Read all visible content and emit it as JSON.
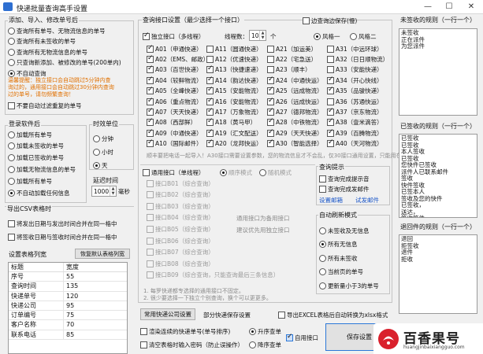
{
  "window": {
    "title": "快递批量查询高手设置",
    "min": "—",
    "max": "☐",
    "close": "✕"
  },
  "add_group": {
    "title": "添加、导入、修改单号后",
    "options": [
      {
        "label": "查询所有单号、无物流信息的单号",
        "checked": false
      },
      {
        "label": "查询所有未签收的单号",
        "checked": false
      },
      {
        "label": "查询所有无物流信息的单号",
        "checked": false
      },
      {
        "label": "只查询新添加、被修改的单号(200单内)",
        "checked": false
      },
      {
        "label": "不自动查询",
        "checked": true
      }
    ],
    "tip_lines": [
      "温馨提醒：独立接口会自动跳过5分钟内查",
      "询过的，通用接口会自动跳过30分钟内查询",
      "过的单号，请勿频繁查询！"
    ],
    "filter_label": "不要自动过滤重复的单号"
  },
  "login": {
    "title": "登录软件后",
    "options": [
      {
        "label": "加载所有单号",
        "checked": false
      },
      {
        "label": "加载未签收的单号",
        "checked": false
      },
      {
        "label": "加载已签收的单号",
        "checked": false
      },
      {
        "label": "加载无物流信息的单号",
        "checked": false
      },
      {
        "label": "加载所有单号",
        "checked": false
      },
      {
        "label": "不自动加载任何信息",
        "checked": true
      }
    ]
  },
  "time_unit": {
    "title": "时效单位",
    "options": [
      {
        "label": "分钟",
        "checked": false
      },
      {
        "label": "小时",
        "checked": false
      },
      {
        "label": "天",
        "checked": true
      }
    ]
  },
  "delay": {
    "label": "延迟时间",
    "value": "1000",
    "unit": "毫秒"
  },
  "export": {
    "title": "导出CSV表格时",
    "options": [
      "将发出日期与发出时间合并在同一格中",
      "将签收日期与签收时间合并在同一格中"
    ]
  },
  "table_setting": {
    "title": "设置表格列宽",
    "reset": "恢复默认表格列宽",
    "headers": [
      "标题",
      "宽度"
    ],
    "rows": [
      [
        "序号",
        "55"
      ],
      [
        "查询时间",
        "135"
      ],
      [
        "快递单号",
        "120"
      ],
      [
        "快递公司",
        "95"
      ],
      [
        "订单编号",
        "75"
      ],
      [
        "客户名称",
        "70"
      ],
      [
        "联系电话",
        "85"
      ]
    ]
  },
  "query": {
    "title": "查询接口设置（最少选择一个接口）",
    "side_query_label": "边查询边保存(慢)",
    "independent_label": "独立接口（多线程）",
    "threads_label": "线程数：",
    "threads_value": "10",
    "threads_unit": "个",
    "style1": "风格一",
    "style2": "风格二",
    "interfaces": [
      [
        "A01（申通快递）",
        "A11（圆通快递）",
        "A21（加运美）",
        "A31（中远环球）"
      ],
      [
        "A02（EMS、邮政）",
        "A12（优速快递）",
        "A22（宅急送）",
        "A32（日日顺物流）"
      ],
      [
        "A03（百世快递）",
        "A13（快捷速递）",
        "A23（顺丰）",
        "A33（安能快递）"
      ],
      [
        "A04（较鲜物流）",
        "A14（韵达快递）",
        "A24（中通快运）",
        "A34（开心快线）"
      ],
      [
        "A05（全峰快递）",
        "A15（安能物流）",
        "A25（远成物流）",
        "A35（品骏快递）"
      ],
      [
        "A06（重点物流）",
        "A16（安能物流）",
        "A26（远成快运）",
        "A36（苏通快运）"
      ],
      [
        "A07（天天快递）",
        "A17（万象物流）",
        "A27（德邦物流）",
        "A37（京东物流）"
      ],
      [
        "A08（西部鲜）",
        "A18（黄马甲）",
        "A28（中铁物流）",
        "A38（壹米滴答）"
      ],
      [
        "A09（中通快递）",
        "A19（汇文配送）",
        "A29（天天快递）",
        "A39（百腾物流）"
      ],
      [
        "A10（国际邮件）",
        "A20（龙邦快运）",
        "A30（智能选择）",
        "A40（天河物流）"
      ]
    ],
    "unchecked_cells": [
      "0-1",
      "0-2",
      "0-3",
      "1-1",
      "1-2",
      "1-3",
      "2-2",
      "2-3",
      "5-3"
    ],
    "note": "顺丰要把电话一起导入！A30接口需要设置参数，您的物流信息才不会乱，仅30接口通用设置，只能用在这一个接口上",
    "general_label": "通用接口（单线程）",
    "order_mode": "顺序模式",
    "random_mode": "随机模式",
    "general_items": [
      "接口B01（综合查询）",
      "接口B02（综合查询）",
      "接口B03（综合查询）",
      "接口B04（综合查询）",
      "接口B05（综合查询）",
      "接口B06（综合查询）",
      "接口B07（综合查询）",
      "接口B08（综合查询）",
      "接口B09（综合查询，只能查询最后三条信息）"
    ],
    "general_note1": "通用接口为备用接口",
    "general_note2": "建议优先用独立接口",
    "bottom_note1": "1. 每罗快递都专选择的通用接口不固定。",
    "bottom_note2": "2. 很少要选择一下独立个别查询，换个可以更更多。"
  },
  "query_tip": {
    "title": "查询提示",
    "opt1": "查询完成提示音",
    "opt2": "查询完成发邮件",
    "mail_setting": "设置邮箱",
    "test_mail": "试发邮件"
  },
  "auto_refresh": {
    "title": "自动刷新模式",
    "options": [
      {
        "label": "未签收及无信息",
        "checked": false
      },
      {
        "label": "所有无信息",
        "checked": true
      },
      {
        "label": "所有未签收",
        "checked": false
      },
      {
        "label": "当前页的单号",
        "checked": false
      },
      {
        "label": "更新量小于3的单号",
        "checked": false
      }
    ]
  },
  "unsigned_rule": {
    "title": "未签收的规则（一行一个）",
    "text": "未签收\n正在派件\n为您派件"
  },
  "signed_rule": {
    "title": "已签收的规则（一行一个）",
    "text": "已签收\n已签收\n本人签收\n已签收\n您快件已签收\n派件人已联系邮件\n签收\n快件签收\n已签本人\n签收及您的快件\n已签收，\n送达，\n签收箱件\n签收送达件\n本人已签收"
  },
  "return_rule": {
    "title": "退回件的规则（一行一个）",
    "text": "退回\n拒签收\n退件\n拒收"
  },
  "bottom": {
    "common_setting": "常用快递公司设置",
    "partial_setting": "部分快递保存设置",
    "export_excel": "导出EXCEL表格后自动转换为xlsx格式",
    "render_label": "渲染连续的快递单号(单号排序)",
    "clear_label": "清空表格时输入密码（防止误操作）",
    "asc": "升序查单",
    "desc": "降序查单",
    "auto_interface": "自用接口",
    "save": "保存设置"
  },
  "logo": {
    "brand": "百香果号",
    "site": "huangjinbaixiangguo.com"
  },
  "colors": {
    "accent": "#2c78d8",
    "warning": "#e07000",
    "brand_red": "#d9202c"
  }
}
